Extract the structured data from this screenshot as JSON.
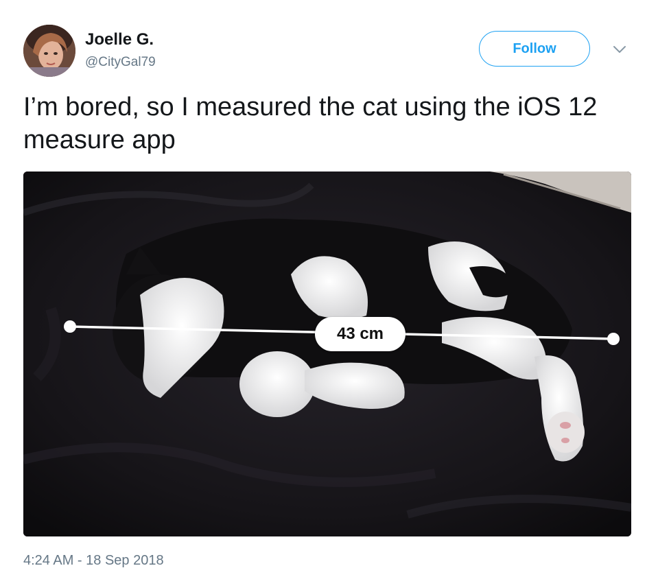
{
  "author": {
    "display_name": "Joelle G.",
    "handle": "@CityGal79",
    "avatar_icon": "user-avatar-photo"
  },
  "follow_button": {
    "label": "Follow",
    "color": "#1da1f2"
  },
  "menu_icon": "chevron-down-icon",
  "tweet": {
    "text": "I’m bored, so I measured the cat using the iOS 12 measure app",
    "timestamp": "4:24 AM - 18 Sep 2018"
  },
  "media": {
    "measurement_label": "43 cm"
  },
  "colors": {
    "accent": "#1da1f2",
    "text_primary": "#14171a",
    "text_secondary": "#657786"
  }
}
